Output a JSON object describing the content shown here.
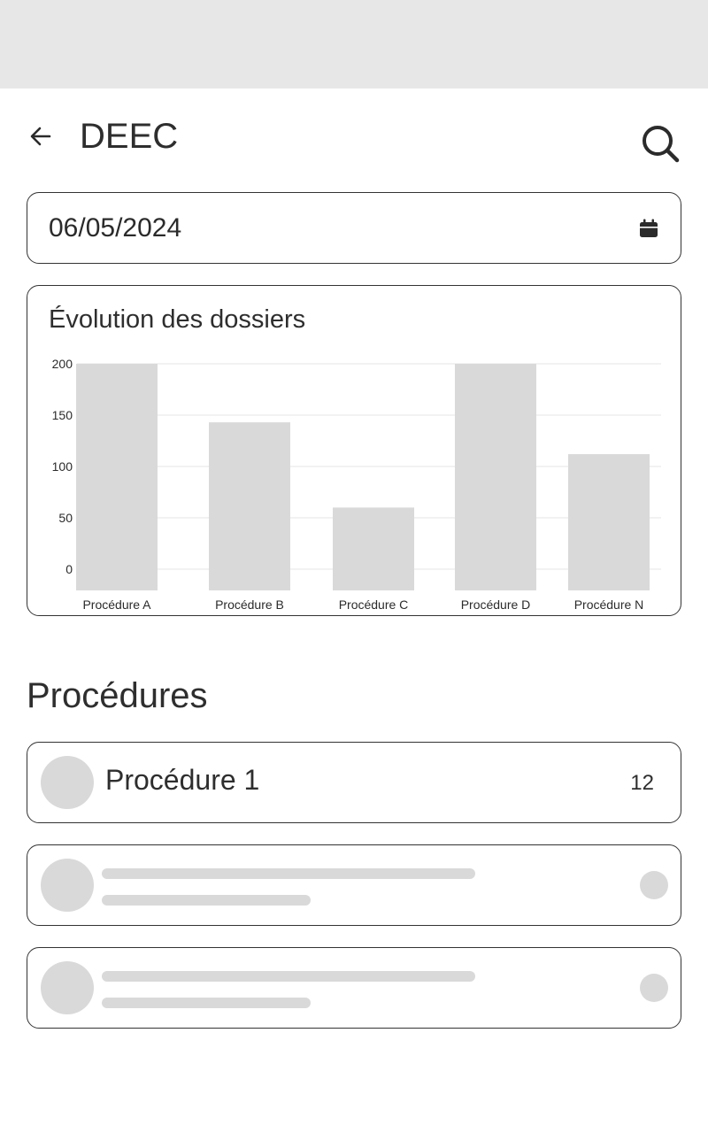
{
  "header": {
    "title": "DEEC",
    "back_icon": "arrow-left-icon",
    "search_icon": "search-icon"
  },
  "date_filter": {
    "value": "06/05/2024",
    "icon": "calendar-icon"
  },
  "chart_data": {
    "type": "bar",
    "title": "Évolution des dossiers",
    "categories": [
      "Procédure A",
      "Procédure B",
      "Procédure C",
      "Procédure D",
      "Procédure N"
    ],
    "values": [
      200,
      143,
      60,
      200,
      112
    ],
    "ylim": [
      0,
      200
    ],
    "yticks": [
      0,
      50,
      100,
      150,
      200
    ],
    "xlabel": "",
    "ylabel": "",
    "grid": true,
    "bar_color": "#d9d9d9"
  },
  "procedures": {
    "title": "Procédures",
    "items": [
      {
        "label": "Procédure 1",
        "count": "12"
      }
    ]
  },
  "colors": {
    "status_bar": "#e7e7e7",
    "placeholder": "#d9d9d9",
    "border": "#333333"
  }
}
